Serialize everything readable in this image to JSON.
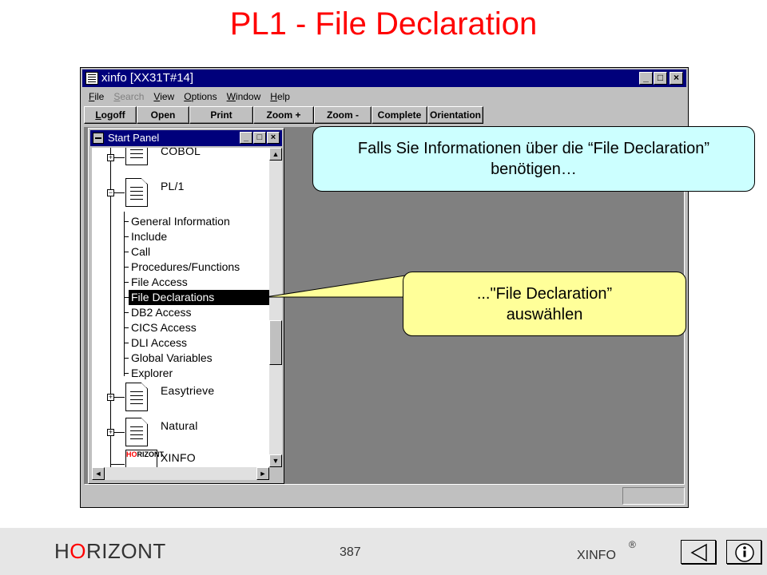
{
  "slide": {
    "title": "PL1 - File Declaration"
  },
  "window": {
    "title": "xinfo [XX31T#14]",
    "controls": {
      "minimize": "_",
      "maximize": "□",
      "close": "×"
    }
  },
  "menu": {
    "items": [
      {
        "label": "File",
        "hot": "F",
        "rest": "ile",
        "disabled": false
      },
      {
        "label": "Search",
        "hot": "S",
        "rest": "earch",
        "disabled": true
      },
      {
        "label": "View",
        "hot": "V",
        "rest": "iew",
        "disabled": false
      },
      {
        "label": "Options",
        "hot": "O",
        "rest": "ptions",
        "disabled": false
      },
      {
        "label": "Window",
        "hot": "W",
        "rest": "indow",
        "disabled": false
      },
      {
        "label": "Help",
        "hot": "H",
        "rest": "elp",
        "disabled": false
      }
    ]
  },
  "toolbar": {
    "buttons": [
      {
        "label": "Logoff",
        "hot": "L",
        "rest": "ogoff"
      },
      {
        "label": "Open"
      },
      {
        "label": "Print"
      },
      {
        "label": "Zoom +"
      },
      {
        "label": "Zoom -"
      },
      {
        "label": "Complete"
      },
      {
        "label": "Orientation"
      }
    ]
  },
  "start_panel": {
    "title": "Start Panel",
    "groups": {
      "cobol": "COBOL",
      "pl1": "PL/1",
      "easytrieve": "Easytrieve",
      "natural": "Natural",
      "xinfo": "XINFO"
    },
    "pl1_items": [
      "General Information",
      "Include",
      "Call",
      "Procedures/Functions",
      "File Access",
      "File Declarations",
      "DB2 Access",
      "CICS Access",
      "DLI Access",
      "Global Variables",
      "Explorer"
    ],
    "selected_item": "File Declarations",
    "logo": {
      "top_red": "HO",
      "top_rest": "RIZONT"
    }
  },
  "callouts": {
    "info": "Falls Sie Informationen über die “File Declaration” benötigen…",
    "action": "...\"File Declaration” auswählen"
  },
  "footer": {
    "brand_pre": "H",
    "brand_accent": "O",
    "brand_post": "RIZONT",
    "page_number": "387",
    "product": "XINFO",
    "registered": "®"
  },
  "colors": {
    "title_red": "#ff0000",
    "titlebar_blue": "#00007b",
    "callout_info_bg": "#ccffff",
    "callout_action_bg": "#ffff99"
  }
}
